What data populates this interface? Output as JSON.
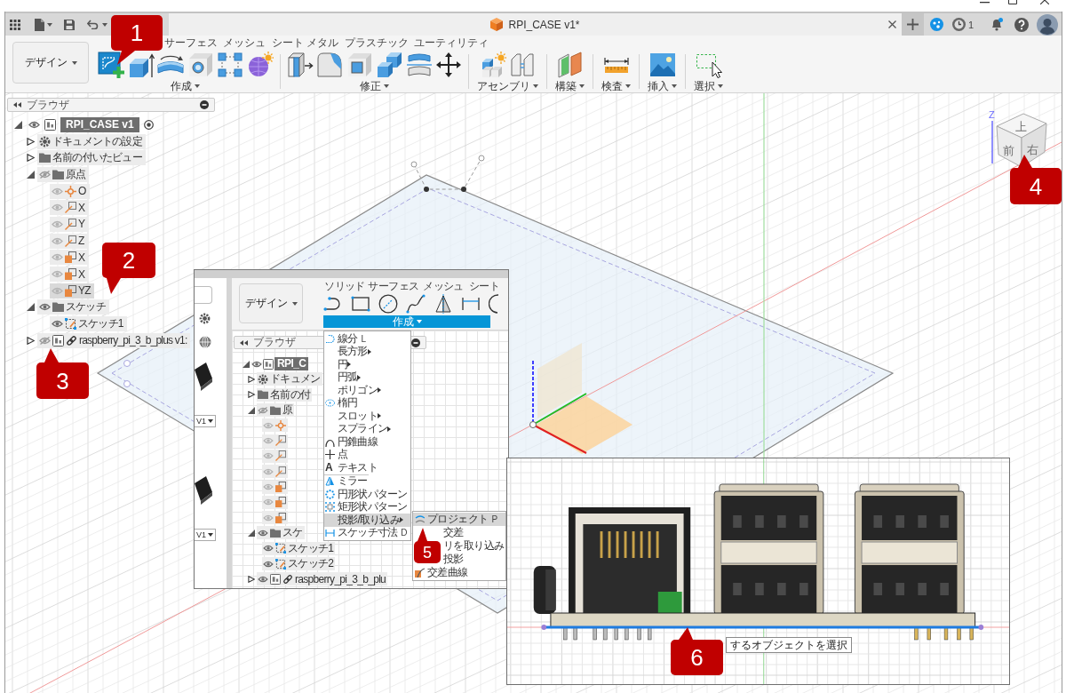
{
  "document_tab": {
    "title": "RPI_CASE v1*"
  },
  "job_status": {
    "count": "1"
  },
  "toolbar": {
    "workspace": "デザイン",
    "tabs": [
      "サーフェス",
      "メッシュ",
      "シート メタル",
      "プラスチック",
      "ユーティリティ"
    ],
    "panels": [
      {
        "label": "作成"
      },
      {
        "label": "修正"
      },
      {
        "label": "アセンブリ"
      },
      {
        "label": "構築"
      },
      {
        "label": "検査"
      },
      {
        "label": "挿入"
      },
      {
        "label": "選択"
      }
    ]
  },
  "browser": {
    "title": "ブラウザ",
    "tree": [
      {
        "label": "RPI_CASE v1",
        "kind": "component",
        "expanded": true,
        "visible": true,
        "active": true,
        "selected": false,
        "children": [
          {
            "label": "ドキュメントの設定",
            "kind": "settings",
            "expanded": false,
            "selected": false
          },
          {
            "label": "名前の付いたビュー",
            "kind": "folder",
            "expanded": false,
            "selected": false
          },
          {
            "label": "原点",
            "kind": "folder",
            "expanded": true,
            "visible": false,
            "selected": false,
            "children": [
              {
                "label": "O",
                "kind": "point",
                "visible": true,
                "selected": false
              },
              {
                "label": "X",
                "kind": "axis",
                "visible": true,
                "selected": false
              },
              {
                "label": "Y",
                "kind": "axis",
                "visible": true,
                "selected": false
              },
              {
                "label": "Z",
                "kind": "axis",
                "visible": true,
                "selected": false
              },
              {
                "label": "X",
                "kind": "plane",
                "visible": true,
                "selected": false
              },
              {
                "label": "X",
                "kind": "plane",
                "visible": true,
                "selected": false
              },
              {
                "label": "YZ",
                "kind": "plane",
                "visible": true,
                "selected": true
              }
            ]
          },
          {
            "label": "スケッチ",
            "kind": "folder",
            "expanded": true,
            "visible": true,
            "selected": false,
            "children": [
              {
                "label": "スケッチ1",
                "kind": "sketch",
                "visible": true,
                "selected": false
              }
            ]
          },
          {
            "label": "raspberry_pi_3_b_plus v1:",
            "kind": "linked_component",
            "expanded": false,
            "visible": false,
            "active": false,
            "selected": false
          }
        ]
      }
    ]
  },
  "view_cube": {
    "axis": "Z",
    "faces": [
      "上",
      "前",
      "右"
    ]
  },
  "inset_screenshot": {
    "data_panel": {
      "versions": [
        "V1",
        "V1"
      ]
    },
    "toolbar": {
      "workspace": "デザイン",
      "tabs": [
        "ソリッド",
        "サーフェス",
        "メッシュ",
        "シート"
      ],
      "panel": {
        "label": "作成",
        "open": true
      }
    },
    "browser": {
      "title": "ブラウザ",
      "tree": [
        {
          "label": "RPI_C",
          "kind": "component",
          "expanded": true,
          "visible": true,
          "active": true,
          "children": [
            {
              "label": "ドキュメン",
              "kind": "settings",
              "expanded": false
            },
            {
              "label": "名前の付",
              "kind": "folder",
              "expanded": false
            },
            {
              "label": "原",
              "kind": "folder",
              "expanded": true,
              "visible": false,
              "children": [
                {
                  "kind": "point",
                  "visible": true
                },
                {
                  "kind": "axis",
                  "visible": true
                },
                {
                  "kind": "axis",
                  "visible": true
                },
                {
                  "kind": "axis",
                  "visible": true
                },
                {
                  "kind": "plane",
                  "visible": true
                },
                {
                  "kind": "plane",
                  "visible": true
                },
                {
                  "kind": "plane",
                  "visible": true
                }
              ]
            },
            {
              "label": "スケ",
              "kind": "folder",
              "expanded": true,
              "visible": true,
              "children": [
                {
                  "label": "スケッチ1",
                  "kind": "sketch",
                  "visible": true
                },
                {
                  "label": "スケッチ2",
                  "kind": "sketch",
                  "visible": true
                }
              ]
            },
            {
              "label": "raspberry_pi_3_b_plu",
              "kind": "linked_component",
              "expanded": false,
              "visible": true,
              "active": false
            }
          ]
        }
      ]
    },
    "menu": {
      "items": [
        {
          "label": "線分",
          "shortcut": "L",
          "submenu": false,
          "selected": false
        },
        {
          "label": "長方形",
          "submenu": true,
          "selected": false
        },
        {
          "label": "円",
          "submenu": true,
          "selected": false
        },
        {
          "label": "円弧",
          "submenu": true,
          "selected": false
        },
        {
          "label": "ポリゴン",
          "submenu": true,
          "selected": false
        },
        {
          "label": "楕円",
          "submenu": false,
          "selected": false
        },
        {
          "label": "スロット",
          "submenu": true,
          "selected": false
        },
        {
          "label": "スプライン",
          "submenu": true,
          "selected": false
        },
        {
          "label": "円錐曲線",
          "submenu": false,
          "selected": false
        },
        {
          "label": "点",
          "submenu": false,
          "selected": false
        },
        {
          "label": "テキスト",
          "glyph": "A",
          "submenu": false,
          "selected": false
        },
        {
          "label": "ミラー",
          "divider_above": true,
          "submenu": false,
          "selected": false
        },
        {
          "label": "円形状パターン",
          "submenu": false,
          "selected": false
        },
        {
          "label": "矩形状パターン",
          "submenu": false,
          "selected": false
        },
        {
          "label": "投影/取り込み",
          "submenu": true,
          "selected": true
        },
        {
          "label": "スケッチ寸法",
          "shortcut": "D",
          "submenu": false,
          "selected": false
        }
      ],
      "submenu": {
        "items": [
          {
            "label": "プロジェクト",
            "shortcut": "P",
            "selected": true
          },
          {
            "label": "交差",
            "selected": false
          },
          {
            "label": "リを取り込み",
            "selected": false
          },
          {
            "label": "投影",
            "selected": false
          },
          {
            "label": "交差曲線",
            "selected": false
          }
        ]
      }
    }
  },
  "front_view_inset": {
    "tooltip": "するオブジェクトを選択"
  },
  "callouts": [
    {
      "number": "1"
    },
    {
      "number": "2"
    },
    {
      "number": "3"
    },
    {
      "number": "4"
    },
    {
      "number": "5"
    },
    {
      "number": "6"
    }
  ]
}
